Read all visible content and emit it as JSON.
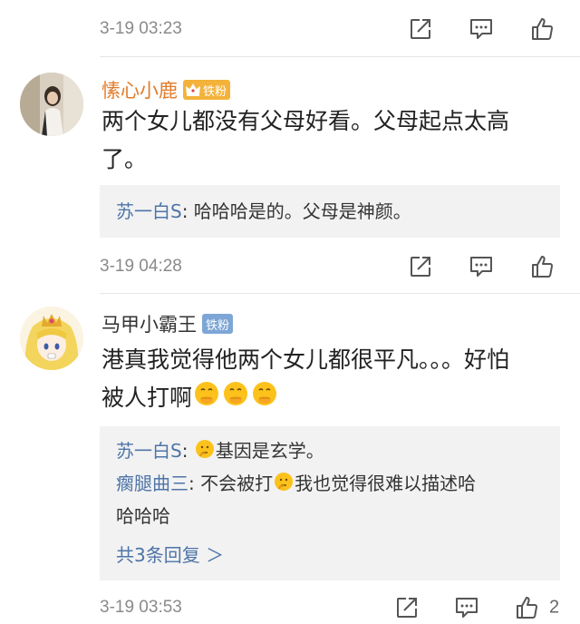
{
  "top_bar": {
    "time": "3-19 03:23"
  },
  "comments": [
    {
      "username": "愫心小鹿",
      "username_color": "#e07b2a",
      "badge": "铁粉",
      "content_line1": "两个女儿都没有父母好看。父母起点太高",
      "content_line2": "了。",
      "reply": {
        "author": "苏一白S",
        "text": ": 哈哈哈是的。父母是神颜。"
      },
      "time": "3-19 04:28"
    },
    {
      "username": "马甲小霸王",
      "username_color": "#333333",
      "badge": "铁粉",
      "content_line1": "港真我觉得他两个女儿都很平凡。。。好怕",
      "content_line2": "被人打啊",
      "replies": [
        {
          "author": "苏一白S",
          "text_before": ": ",
          "text_after": "基因是玄学。"
        },
        {
          "author": "瘸腿曲三",
          "text_before": ": 不会被打",
          "text_after": "我也觉得很难以描述哈",
          "text_line2": "哈哈哈"
        }
      ],
      "more_replies": "共3条回复 ＞",
      "time": "3-19 03:53",
      "like_count": "2"
    }
  ],
  "icons": {
    "share": "share-icon",
    "comment": "comment-icon",
    "like": "thumbs-up-icon"
  },
  "colors": {
    "link": "#4d74a8",
    "reply_bg": "#f2f2f2",
    "time": "#8a8a8a",
    "badge_blue": "#7da6d6",
    "badge_gold": "#f3b23a"
  }
}
